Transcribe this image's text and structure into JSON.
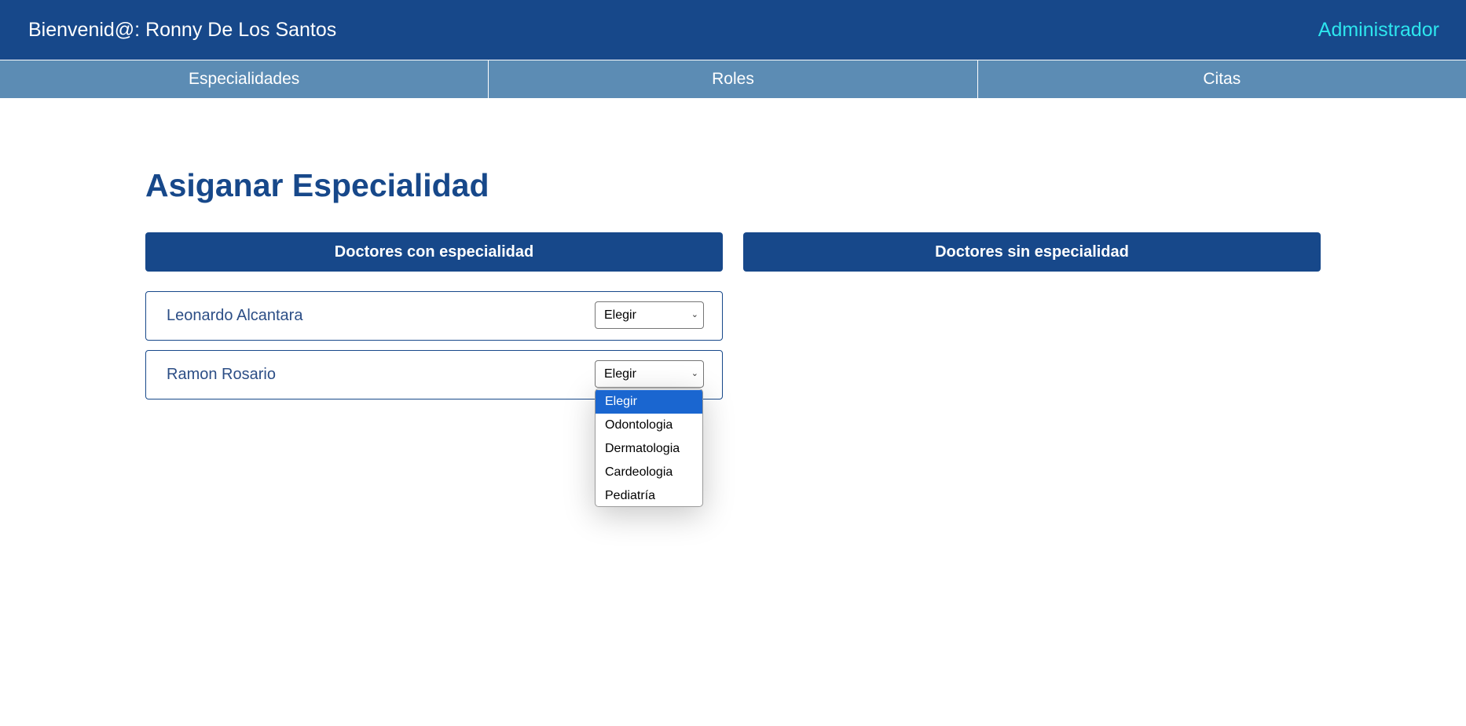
{
  "header": {
    "welcome": "Bienvenid@: Ronny De Los Santos",
    "role": "Administrador"
  },
  "nav": {
    "items": [
      {
        "label": "Especialidades"
      },
      {
        "label": "Roles"
      },
      {
        "label": "Citas"
      }
    ]
  },
  "main": {
    "title": "Asiganar Especialidad",
    "with_specialty_header": "Doctores con especialidad",
    "without_specialty_header": "Doctores sin especialidad",
    "doctors": [
      {
        "name": "Leonardo Alcantara",
        "selected": "Elegir"
      },
      {
        "name": "Ramon Rosario",
        "selected": "Elegir"
      }
    ]
  },
  "dropdown": {
    "selected": "Elegir",
    "options": [
      "Elegir",
      "Odontologia",
      "Dermatologia",
      "Cardeologia",
      "Pediatría"
    ]
  },
  "colors": {
    "primary": "#17488a",
    "nav": "#5c8cb4",
    "accent": "#2de6ee",
    "option_highlight": "#1a66d0"
  }
}
